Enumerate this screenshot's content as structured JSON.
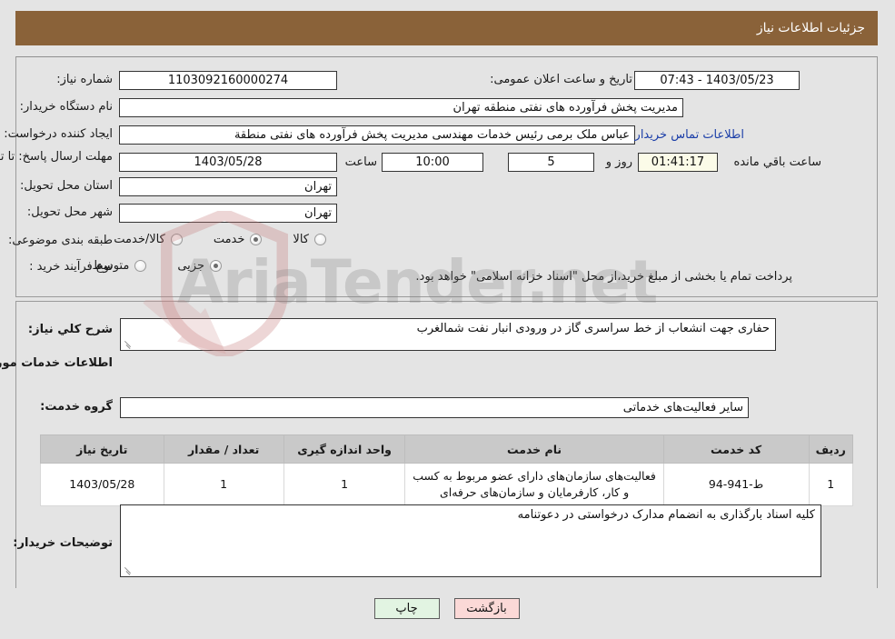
{
  "page": {
    "title": "جزئیات اطلاعات نیاز",
    "header_color": "#8a6239",
    "watermark_text": "AriaTender.net"
  },
  "summary": {
    "need_number_label": "شماره نیاز:",
    "need_number_value": "1103092160000274",
    "announce_label": "تاریخ و ساعت اعلان عمومی:",
    "announce_value": "1403/05/23 - 07:43",
    "buyer_org_label": "نام دستگاه خریدار:",
    "buyer_org_value": "مدیریت پخش فرآورده های نفتی منطقه تهران",
    "creator_label": "ایجاد کننده درخواست:",
    "creator_value": "عباس ملک برمی رئیس خدمات مهندسی مدیریت پخش فرآورده های نفتی منطقة",
    "contact_link": "اطلاعات تماس خریدار",
    "deadline_label": "مهلت ارسال پاسخ: تا تاریخ:",
    "deadline_date": "1403/05/28",
    "deadline_hour_label": "ساعت",
    "deadline_hour": "10:00",
    "remaining_days": "5",
    "remaining_days_suffix": "روز و",
    "remaining_time": "01:41:17",
    "remaining_time_suffix": "ساعت باقي مانده",
    "province_label": "استان محل تحویل:",
    "province_value": "تهران",
    "city_label": "شهر محل تحویل:",
    "city_value": "تهران",
    "category_label": "طبقه بندی موضوعی:",
    "category_options": [
      {
        "label": "کالا",
        "selected": false
      },
      {
        "label": "خدمت",
        "selected": true
      },
      {
        "label": "کالا/خدمت",
        "selected": false
      }
    ],
    "process_label": "نوع فرآیند خرید :",
    "process_options": [
      {
        "label": "جزیی",
        "selected": true
      },
      {
        "label": "متوسط",
        "selected": false
      }
    ],
    "payment_note": "پرداخت تمام یا بخشی از مبلغ خرید،از محل \"اسناد خزانه اسلامی\" خواهد بود."
  },
  "details": {
    "general_label": "شرح کلي نیاز:",
    "general_value": "حفاری جهت انشعاب از خط سراسری گاز در ورودی انبار نفت شمالغرب",
    "services_heading": "اطلاعات خدمات مورد نیاز",
    "service_group_label": "گروه خدمت:",
    "service_group_value": "سایر فعالیت‌های خدماتی",
    "buyer_notes_label": "توضیحات خریدار:",
    "buyer_notes_value": "کلیه اسناد بارگذاری به انضمام مدارک درخواستی در دعوتنامه"
  },
  "items_table": {
    "columns": [
      "ردیف",
      "کد خدمت",
      "نام خدمت",
      "واحد اندازه گیری",
      "تعداد / مقدار",
      "تاریخ نیاز"
    ],
    "rows": [
      {
        "index": "1",
        "code": "ط-941-94",
        "name": "فعالیت‌های سازمان‌های دارای عضو مربوط به کسب و کار، کارفرمایان و سازمان‌های حرفه‌ای",
        "unit": "1",
        "quantity": "1",
        "date": "1403/05/28"
      }
    ]
  },
  "footer": {
    "print_label": "چاپ",
    "back_label": "بازگشت"
  }
}
